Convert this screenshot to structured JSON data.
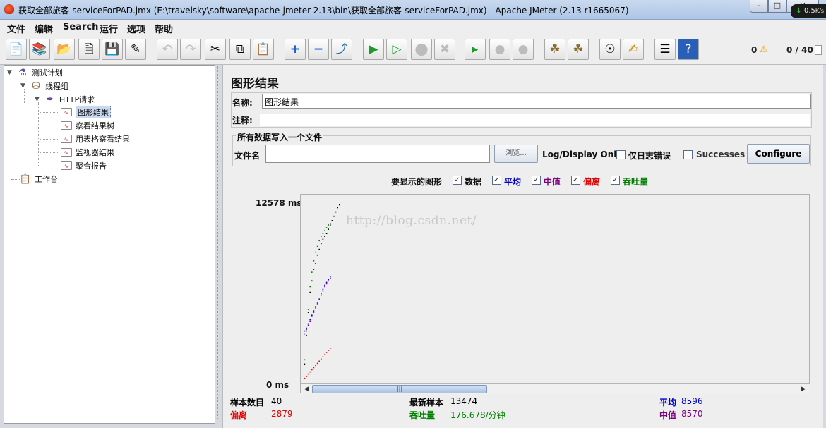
{
  "window": {
    "title": "获取全部旅客-serviceForPAD.jmx (E:\\travelsky\\software\\apache-jmeter-2.13\\bin\\获取全部旅客-serviceForPAD.jmx) - Apache JMeter (2.13 r1665067)",
    "net_speed": "0.5",
    "net_unit": "K/s"
  },
  "menu": [
    "文件",
    "编辑",
    "Search",
    "运行",
    "选项",
    "帮助"
  ],
  "toolbar": {
    "error_count": "0",
    "threads": "0 / 40"
  },
  "tree": {
    "items": [
      {
        "label": "测试计划",
        "icon": "flask-icon"
      },
      {
        "label": "线程组",
        "icon": "spool-icon"
      },
      {
        "label": "HTTP请求",
        "icon": "pipette-icon"
      },
      {
        "label": "图形结果",
        "icon": "listener-icon"
      },
      {
        "label": "察看结果树",
        "icon": "listener-icon"
      },
      {
        "label": "用表格察看结果",
        "icon": "listener-icon"
      },
      {
        "label": "监视器结果",
        "icon": "listener-icon"
      },
      {
        "label": "聚合报告",
        "icon": "listener-icon"
      },
      {
        "label": "工作台",
        "icon": "clipboard-icon"
      }
    ]
  },
  "panel": {
    "title": "图形结果",
    "name_label": "名称:",
    "name_value": "图形结果",
    "comment_label": "注释:",
    "comment_value": "",
    "file_section_title": "所有数据写入一个文件",
    "filename_label": "文件名",
    "filename_value": "",
    "browse_label": "浏览...",
    "log_display_label": "Log/Display Only:",
    "errors_only_label": "仅日志错误",
    "successes_label": "Successes",
    "configure_label": "Configure",
    "graphs_label": "要显示的图形",
    "graph_options": [
      {
        "label": "数据",
        "checked": true,
        "color": "#000000"
      },
      {
        "label": "平均",
        "checked": true,
        "color": "#0000ff"
      },
      {
        "label": "中值",
        "checked": true,
        "color": "#800080"
      },
      {
        "label": "偏离",
        "checked": true,
        "color": "#ff0000"
      },
      {
        "label": "吞吐量",
        "checked": true,
        "color": "#008000"
      }
    ]
  },
  "chart_data": {
    "type": "scatter",
    "title": "",
    "xlabel": "",
    "ylabel": "",
    "y_max_label": "12578  ms",
    "y_min_label": "0  ms",
    "ylim": [
      0,
      12578
    ],
    "xlim": [
      0,
      40
    ],
    "watermark": "http://blog.csdn.net/",
    "grid": false,
    "series": [
      {
        "name": "数据",
        "color": "#000000",
        "values": [
          [
            1,
            1200
          ],
          [
            2,
            3200
          ],
          [
            3,
            4800
          ],
          [
            4,
            6200
          ],
          [
            5,
            7000
          ],
          [
            6,
            7800
          ],
          [
            7,
            8200
          ],
          [
            8,
            8800
          ],
          [
            9,
            9200
          ],
          [
            10,
            9600
          ],
          [
            11,
            9900
          ],
          [
            12,
            10100
          ],
          [
            13,
            10300
          ],
          [
            14,
            10600
          ],
          [
            15,
            10900
          ],
          [
            16,
            11200
          ],
          [
            17,
            11500
          ],
          [
            18,
            11800
          ],
          [
            19,
            12100
          ],
          [
            20,
            12300
          ]
        ]
      },
      {
        "name": "平均",
        "color": "#0000ff",
        "values": [
          [
            1,
            3500
          ],
          [
            2,
            3700
          ],
          [
            3,
            4000
          ],
          [
            4,
            4300
          ],
          [
            5,
            4600
          ],
          [
            6,
            4900
          ],
          [
            7,
            5200
          ],
          [
            8,
            5500
          ],
          [
            9,
            5800
          ],
          [
            10,
            6100
          ],
          [
            11,
            6400
          ],
          [
            12,
            6700
          ],
          [
            13,
            6900
          ],
          [
            14,
            7100
          ],
          [
            15,
            7300
          ]
        ]
      },
      {
        "name": "中值",
        "color": "#800080",
        "values": [
          [
            1,
            3300
          ],
          [
            2,
            3600
          ],
          [
            3,
            3900
          ],
          [
            4,
            4200
          ],
          [
            5,
            4500
          ],
          [
            6,
            4800
          ],
          [
            7,
            5100
          ],
          [
            8,
            5400
          ],
          [
            9,
            5700
          ],
          [
            10,
            6000
          ],
          [
            11,
            6300
          ],
          [
            12,
            6600
          ],
          [
            13,
            6800
          ],
          [
            14,
            7000
          ],
          [
            15,
            7200
          ]
        ]
      },
      {
        "name": "偏离",
        "color": "#ff0000",
        "values": [
          [
            1,
            200
          ],
          [
            2,
            350
          ],
          [
            3,
            500
          ],
          [
            4,
            650
          ],
          [
            5,
            800
          ],
          [
            6,
            950
          ],
          [
            7,
            1100
          ],
          [
            8,
            1250
          ],
          [
            9,
            1400
          ],
          [
            10,
            1550
          ],
          [
            11,
            1700
          ],
          [
            12,
            1850
          ],
          [
            13,
            2000
          ],
          [
            14,
            2150
          ],
          [
            15,
            2300
          ]
        ]
      },
      {
        "name": "吞吐量",
        "color": "#008000",
        "values": [
          [
            1,
            1500
          ],
          [
            2,
            3500
          ],
          [
            3,
            5000
          ],
          [
            4,
            6600
          ],
          [
            5,
            7600
          ],
          [
            6,
            8400
          ],
          [
            7,
            9000
          ],
          [
            8,
            9400
          ],
          [
            9,
            9800
          ],
          [
            10,
            10100
          ],
          [
            11,
            10300
          ],
          [
            12,
            10500
          ],
          [
            13,
            10700
          ],
          [
            14,
            10900
          ],
          [
            15,
            11000
          ]
        ]
      }
    ]
  },
  "stats": {
    "samples_label": "样本数目",
    "samples_value": "40",
    "latest_label": "最新样本",
    "latest_value": "13474",
    "average_label": "平均",
    "average_value": "8596",
    "deviation_label": "偏离",
    "deviation_value": "2879",
    "throughput_label": "吞吐量",
    "throughput_value": "176.678/分钟",
    "median_label": "中值",
    "median_value": "8570"
  },
  "colors": {
    "black": "#000000",
    "blue": "#0000cc",
    "purple": "#800080",
    "red": "#e00000",
    "green": "#008000"
  }
}
